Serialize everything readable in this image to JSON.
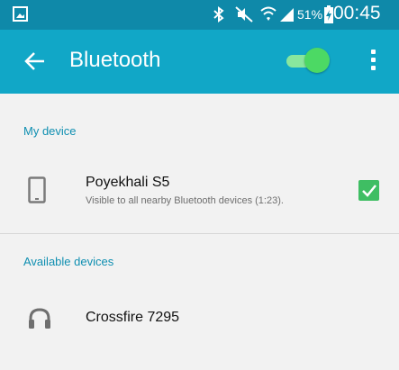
{
  "status_bar": {
    "battery_percent": "51%",
    "time": "00:45",
    "icons": [
      "gallery-icon",
      "bluetooth-icon",
      "mute-icon",
      "wifi-icon",
      "signal-icon",
      "battery-charging-icon"
    ]
  },
  "app_bar": {
    "title": "Bluetooth",
    "back_icon": "arrow-left-icon",
    "bluetooth_enabled": true,
    "menu_icon": "more-vert-icon"
  },
  "my_device_section": {
    "header": "My device",
    "device": {
      "name": "Poyekhali S5",
      "subtitle": "Visible to all nearby Bluetooth devices (1:23).",
      "icon": "smartphone-icon",
      "visible_checked": true
    }
  },
  "available_section": {
    "header": "Available devices",
    "devices": [
      {
        "name": "Crossfire 7295",
        "icon": "headphones-icon"
      }
    ]
  },
  "colors": {
    "status_bar": "#0f89a9",
    "app_bar": "#11a7c7",
    "accent_text": "#0f8fb1",
    "toggle_on": "#4cd964",
    "checkbox": "#3fbe63",
    "background": "#f2f2f2"
  }
}
